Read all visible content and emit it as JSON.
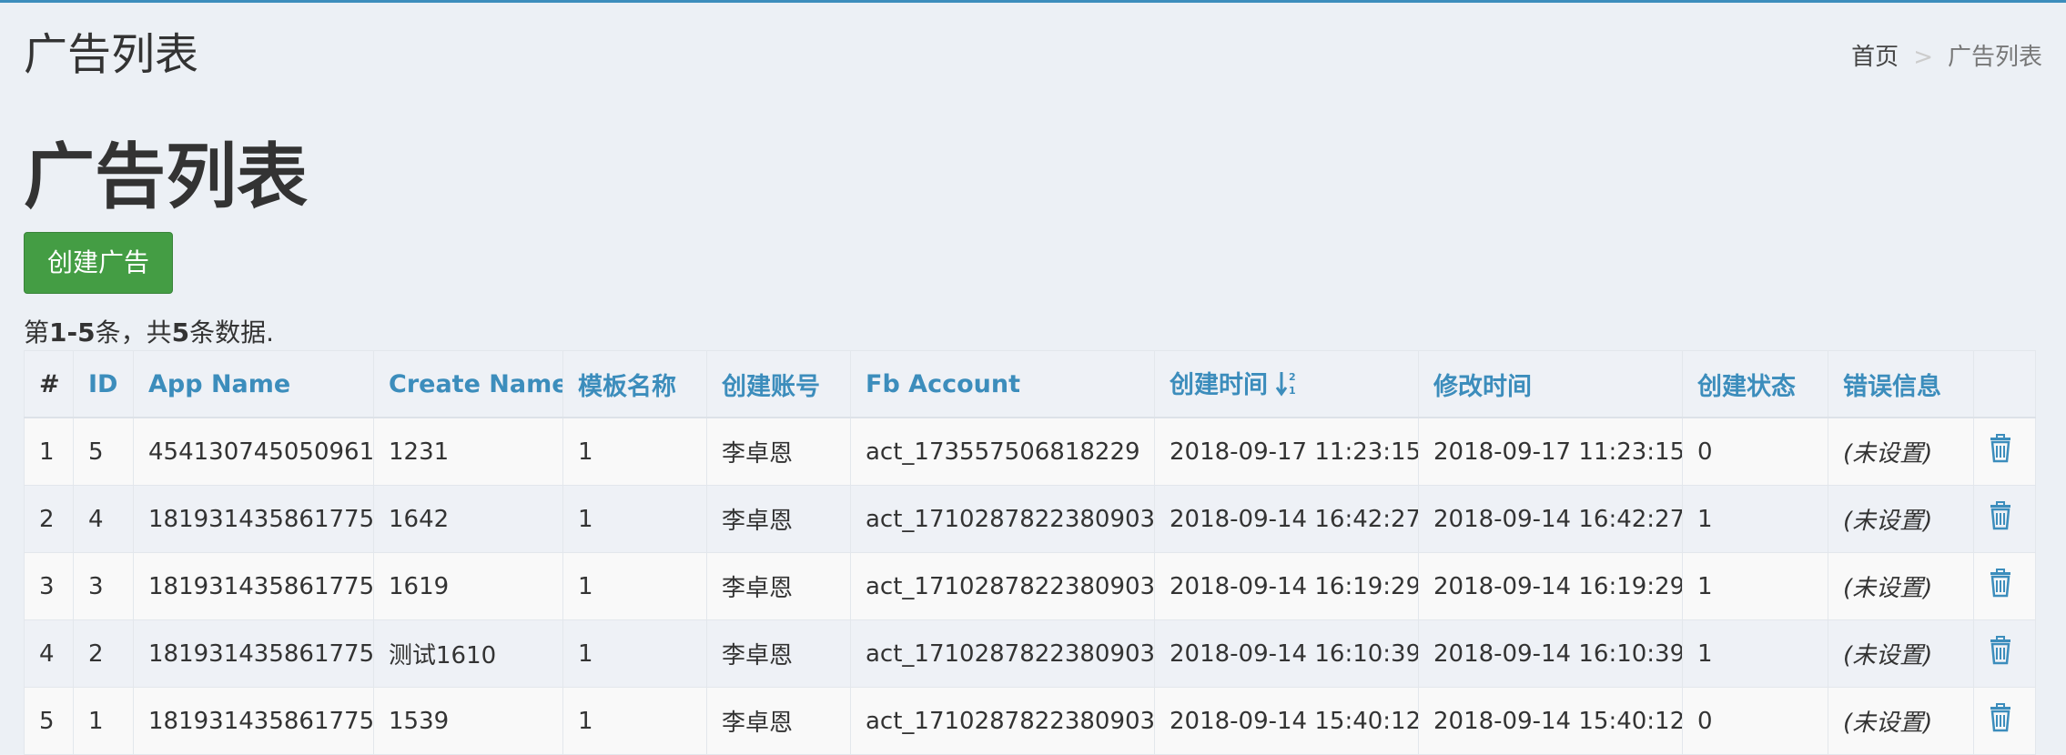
{
  "header": {
    "title": "广告列表",
    "breadcrumb": {
      "home": "首页",
      "separator": ">",
      "current": "广告列表"
    }
  },
  "main": {
    "heading": "广告列表",
    "create_button": "创建广告",
    "summary": {
      "prefix": "第",
      "range": "1-5",
      "middle": "条，共",
      "total": "5",
      "suffix": "条数据."
    },
    "table": {
      "columns": [
        "#",
        "ID",
        "App Name",
        "Create Name",
        "模板名称",
        "创建账号",
        "Fb Account",
        "创建时间",
        "修改时间",
        "创建状态",
        "错误信息",
        ""
      ],
      "rows": [
        {
          "num": "1",
          "id": "5",
          "app_name": "454130745050961",
          "create_name": "1231",
          "template": "1",
          "creator": "李卓恩",
          "fb_account": "act_173557506818229",
          "created": "2018-09-17 11:23:15",
          "modified": "2018-09-17 11:23:15",
          "status": "0",
          "error": "(未设置)"
        },
        {
          "num": "2",
          "id": "4",
          "app_name": "181931435861775",
          "create_name": "1642",
          "template": "1",
          "creator": "李卓恩",
          "fb_account": "act_1710287822380903",
          "created": "2018-09-14 16:42:27",
          "modified": "2018-09-14 16:42:27",
          "status": "1",
          "error": "(未设置)"
        },
        {
          "num": "3",
          "id": "3",
          "app_name": "181931435861775",
          "create_name": "1619",
          "template": "1",
          "creator": "李卓恩",
          "fb_account": "act_1710287822380903",
          "created": "2018-09-14 16:19:29",
          "modified": "2018-09-14 16:19:29",
          "status": "1",
          "error": "(未设置)"
        },
        {
          "num": "4",
          "id": "2",
          "app_name": "181931435861775",
          "create_name": "测试1610",
          "template": "1",
          "creator": "李卓恩",
          "fb_account": "act_1710287822380903",
          "created": "2018-09-14 16:10:39",
          "modified": "2018-09-14 16:10:39",
          "status": "1",
          "error": "(未设置)"
        },
        {
          "num": "5",
          "id": "1",
          "app_name": "181931435861775",
          "create_name": "1539",
          "template": "1",
          "creator": "李卓恩",
          "fb_account": "act_1710287822380903",
          "created": "2018-09-14 15:40:12",
          "modified": "2018-09-14 15:40:12",
          "status": "0",
          "error": "(未设置)"
        }
      ],
      "sort_icon": "sort-numeric-asc-icon",
      "row_action_icon": "trash-icon"
    }
  },
  "colors": {
    "accent": "#3c8dbc",
    "button_green": "#449d44",
    "error_red": "#c0392b",
    "background": "#ecf0f5"
  }
}
